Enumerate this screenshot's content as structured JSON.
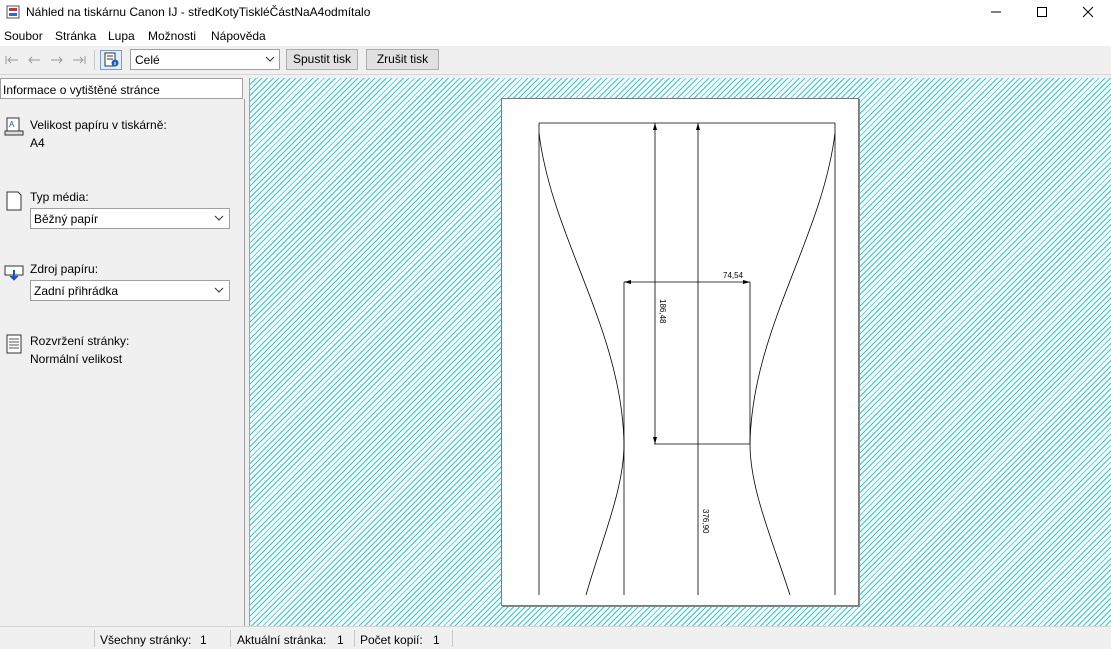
{
  "window": {
    "title": "Náhled na tiskárnu Canon IJ - středKotyTiskléČástNaA4odmítalo",
    "minimize_icon": "minimize-icon",
    "maximize_icon": "maximize-icon",
    "close_icon": "close-icon"
  },
  "menu": [
    "Soubor",
    "Stránka",
    "Lupa",
    "Možnosti",
    "Nápověda"
  ],
  "toolbar": {
    "zoom_value": "Celé",
    "print_label": "Spustit tisk",
    "cancel_label": "Zrušit tisk"
  },
  "panel": {
    "header": "Informace o vytištěné stránce",
    "paper_size_label": "Velikost papíru v tiskárně:",
    "paper_size_value": "A4",
    "media_type_label": "Typ média:",
    "media_type_value": "Běžný papír",
    "paper_source_label": "Zdroj papíru:",
    "paper_source_value": "Zadní přihrádka",
    "layout_label": "Rozvržení stránky:",
    "layout_value": "Normální velikost"
  },
  "drawing": {
    "dim_width": "74,54",
    "dim_inner_height": "186,48",
    "dim_total_height": "376,90"
  },
  "status": {
    "all_pages_label": "Všechny stránky:",
    "all_pages_value": "1",
    "current_page_label": "Aktuální stránka:",
    "current_page_value": "1",
    "copies_label": "Počet kopií:",
    "copies_value": "1"
  }
}
